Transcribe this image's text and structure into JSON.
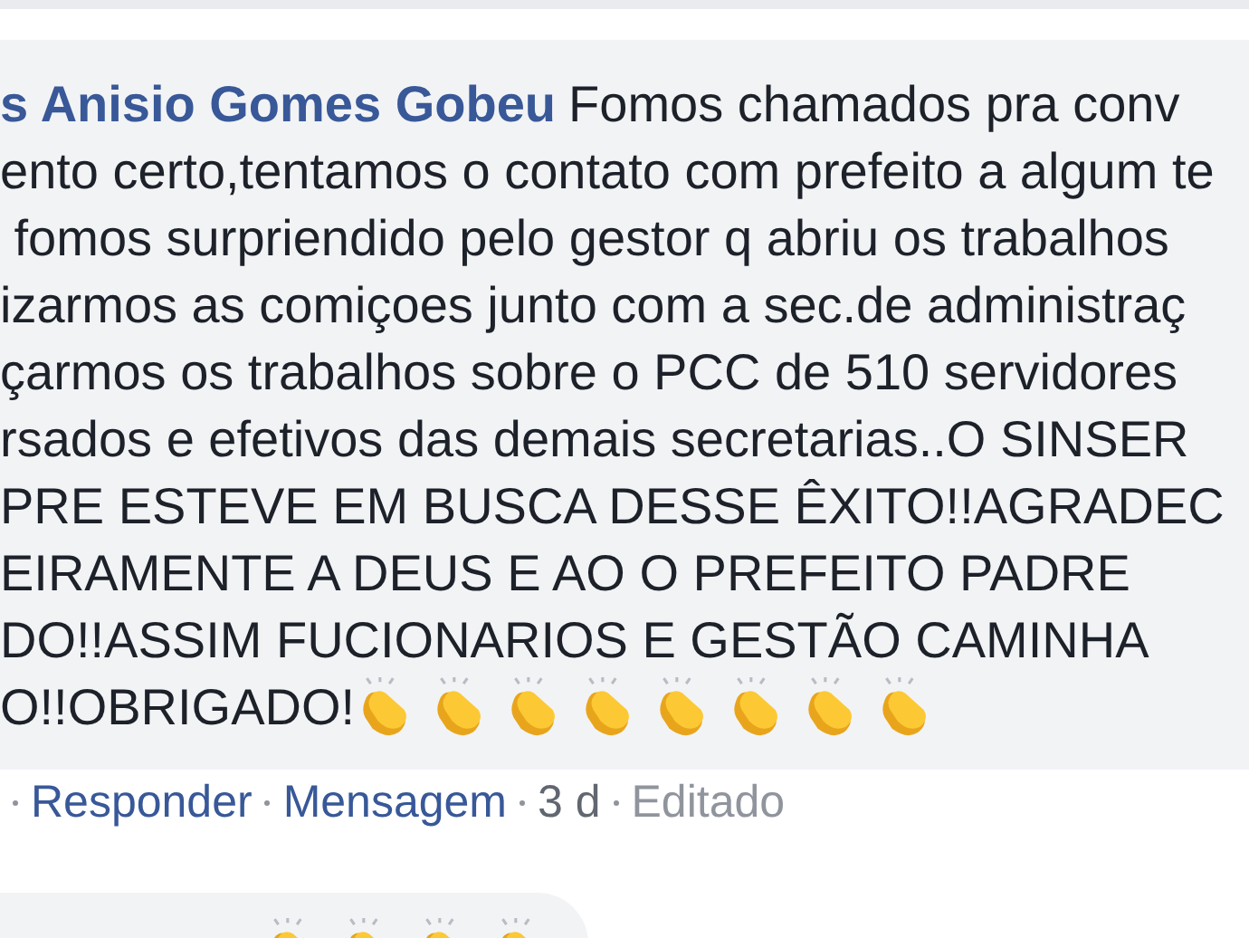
{
  "comment": {
    "author": "s Anisio Gomes Gobeu",
    "lines": [
      "Fomos chamados pra conv",
      "ento certo,tentamos o contato com prefeito a algum te",
      " fomos surpriendido pelo gestor q abriu os trabalhos",
      "izarmos as comiçoes junto com a sec.de administraç",
      "çarmos os trabalhos sobre o PCC de 510 servidores",
      "rsados e efetivos das demais secretarias..O SINSER",
      "PRE ESTEVE EM BUSCA DESSE ÊXITO!!AGRADEC",
      "EIRAMENTE A DEUS E AO O PREFEITO PADRE",
      "DO!!ASSIM FUCIONARIOS E GESTÃO CAMINHA",
      "O!!OBRIGADO!"
    ],
    "actions": [
      {
        "kind": "link",
        "label": "Responder"
      },
      {
        "kind": "link",
        "label": "Mensagem"
      },
      {
        "kind": "time",
        "label": "3 d"
      },
      {
        "kind": "note",
        "label": "Editado"
      }
    ]
  }
}
